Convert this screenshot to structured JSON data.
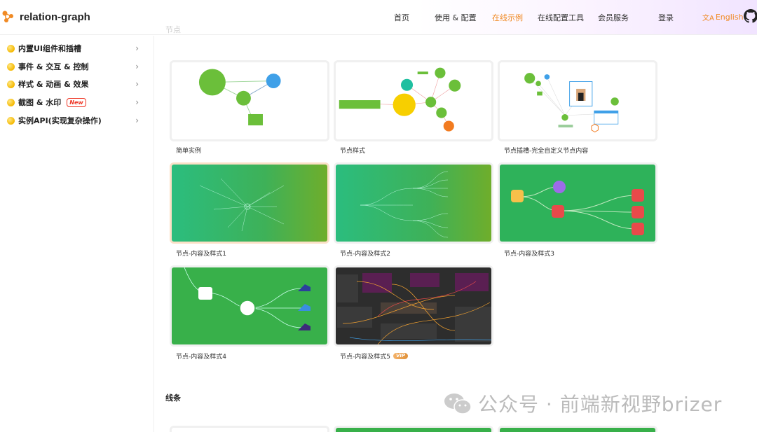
{
  "header": {
    "logo_text": "relation-graph",
    "nav": [
      "首页",
      "使用 & 配置",
      "在线示例",
      "在线配置工具",
      "会员服务",
      "登录"
    ],
    "lang_label": "English",
    "lang_icon": "translate-icon",
    "github_icon": "github-icon"
  },
  "colors": {
    "accent": "#f08a24",
    "badge_red": "#e33322"
  },
  "sidebar": {
    "items": [
      {
        "label": "内置UI组件和插槽",
        "badge": ""
      },
      {
        "label": "事件 & 交互 & 控制",
        "badge": ""
      },
      {
        "label": "样式 & 动画 & 效果",
        "badge": ""
      },
      {
        "label": "截图 & 水印",
        "badge": "New"
      },
      {
        "label": "实例API(实现复杂操作)",
        "badge": ""
      }
    ]
  },
  "main": {
    "section_top_faded": "节点",
    "section_lines": "线条",
    "cards": [
      {
        "label": "简单实例",
        "vip": ""
      },
      {
        "label": "节点样式",
        "vip": ""
      },
      {
        "label": "节点插槽-完全自定义节点内容",
        "vip": ""
      },
      {
        "label": "节点-内容及样式1",
        "vip": ""
      },
      {
        "label": "节点-内容及样式2",
        "vip": ""
      },
      {
        "label": "节点-内容及样式3",
        "vip": ""
      },
      {
        "label": "节点-内容及样式4",
        "vip": ""
      },
      {
        "label": "节点-内容及样式5",
        "vip": "VIP"
      }
    ]
  },
  "watermark": {
    "text": "公众号 · 前端新视野brizer"
  }
}
